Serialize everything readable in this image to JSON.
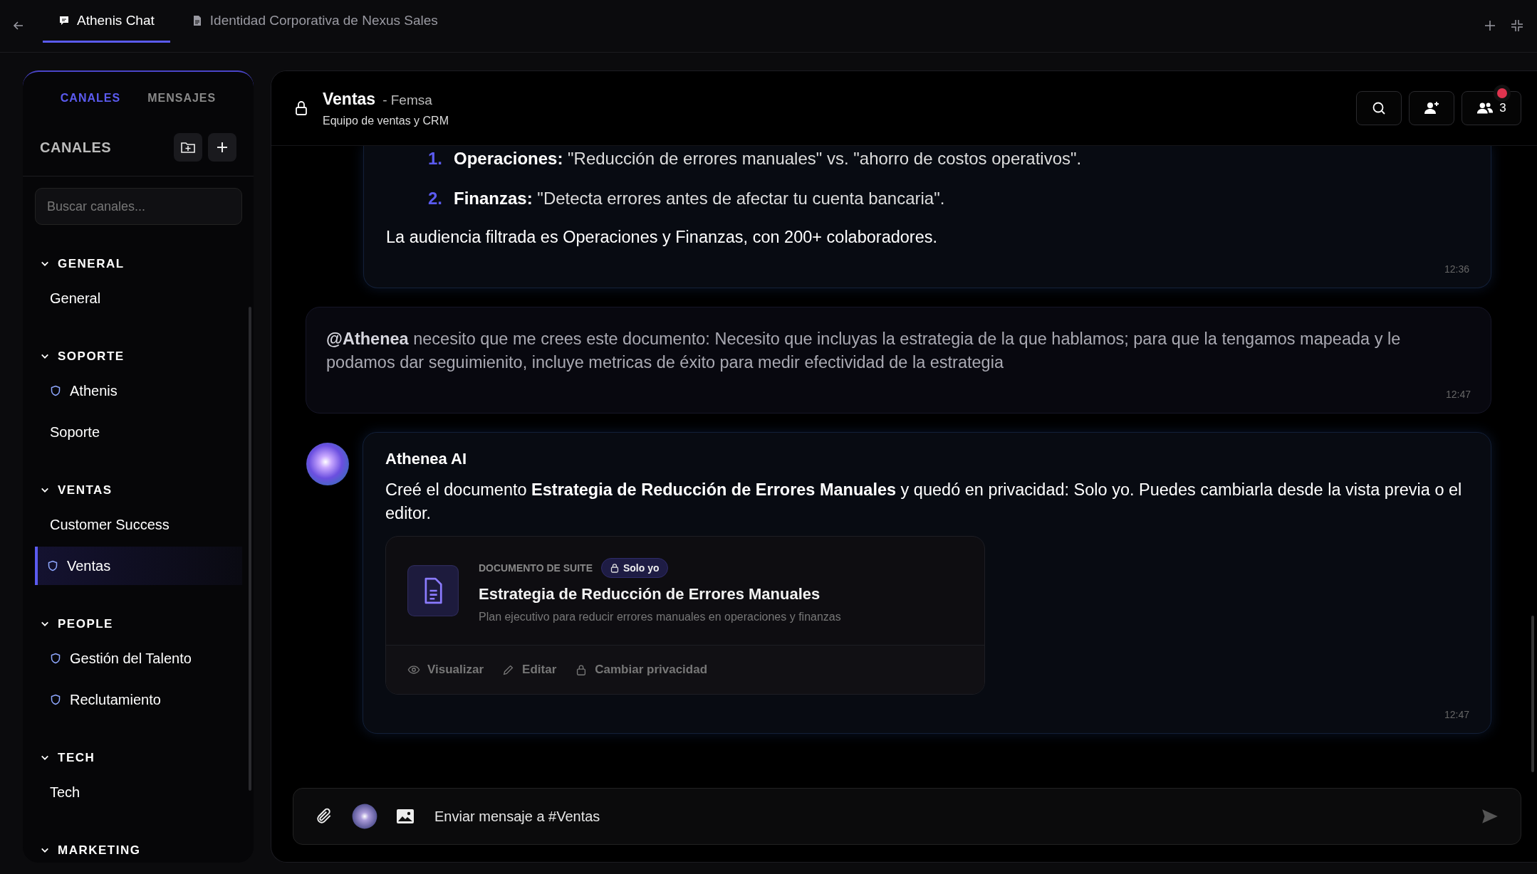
{
  "tabs": [
    {
      "label": "Athenis Chat",
      "selected": true
    },
    {
      "label": "Identidad Corporativa de Nexus Sales",
      "selected": false
    }
  ],
  "sidebar": {
    "tabs": [
      {
        "label": "CANALES",
        "selected": true
      },
      {
        "label": "MENSAJES",
        "selected": false
      }
    ],
    "title": "CANALES",
    "search": {
      "placeholder": "Buscar canales..."
    },
    "groups": [
      {
        "label": "GENERAL",
        "expanded": true,
        "children": [
          {
            "label": "General",
            "private": false,
            "selected": false
          }
        ]
      },
      {
        "label": "SOPORTE",
        "expanded": true,
        "children": [
          {
            "label": "Athenis",
            "private": true,
            "selected": false
          },
          {
            "label": "Soporte",
            "private": false,
            "selected": false
          }
        ]
      },
      {
        "label": "VENTAS",
        "expanded": true,
        "children": [
          {
            "label": "Customer Success",
            "private": false,
            "selected": false
          },
          {
            "label": "Ventas",
            "private": true,
            "selected": true
          }
        ]
      },
      {
        "label": "PEOPLE",
        "expanded": true,
        "children": [
          {
            "label": "Gestión del Talento",
            "private": true,
            "selected": false
          },
          {
            "label": "Reclutamiento",
            "private": true,
            "selected": false
          }
        ]
      },
      {
        "label": "TECH",
        "expanded": true,
        "children": [
          {
            "label": "Tech",
            "private": false,
            "selected": false
          }
        ]
      },
      {
        "label": "MARKETING",
        "expanded": true
      }
    ]
  },
  "channel": {
    "name": "Ventas",
    "org": "- Femsa",
    "description": "Equipo de ventas y CRM",
    "members": "3",
    "notification": true
  },
  "messages": [
    {
      "kind": "ai_continued",
      "items": [
        {
          "number": "1.",
          "text": "**Operaciones:** \"Reducción de errores manuales\" vs. \"ahorro de costos operativos\"."
        },
        {
          "number": "2.",
          "text": "**Finanzas:** \"Detecta errores antes de afectar tu cuenta bancaria\"."
        }
      ],
      "text": "La audiencia filtrada es Operaciones y Finanzas, con 200+ colaboradores.",
      "time": "12:36"
    },
    {
      "kind": "user",
      "text": "**@Athenea** necesito que me crees este documento: Necesito que incluyas la estrategia de la que hablamos; para que la tengamos mapeada y le podamos dar seguimienito, incluye metricas de éxito para medir efectividad de la estrategia",
      "time": "12:47"
    },
    {
      "kind": "ai",
      "author": "Athenea AI",
      "text": "Creé el documento **Estrategia de Reducción de Errores Manuales** y quedó en privacidad: Solo yo. Puedes cambiarla desde la vista previa o el editor.",
      "time": "12:47",
      "attachment": {
        "label": "DOCUMENTO DE SUITE",
        "privacy": "Solo yo",
        "title": "Estrategia de Reducción de Errores Manuales",
        "description": "Plan ejecutivo para reducir errores manuales en operaciones y finanzas",
        "actions": [
          {
            "label": "Visualizar"
          },
          {
            "label": "Editar"
          },
          {
            "label": "Cambiar privacidad"
          }
        ]
      }
    }
  ],
  "composer": {
    "placeholder": "Enviar mensaje a #Ventas"
  }
}
